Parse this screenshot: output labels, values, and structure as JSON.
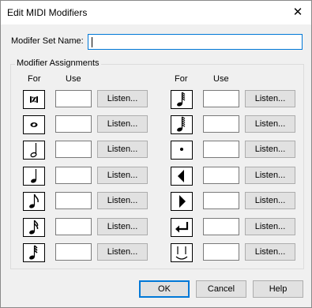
{
  "window": {
    "title": "Edit MIDI Modifiers",
    "close_icon": "close-icon"
  },
  "modifier_set": {
    "label": "Modifer Set Name:",
    "value": ""
  },
  "assignments": {
    "group_label": "Modifier Assignments",
    "col_for": "For",
    "col_use": "Use",
    "listen_label": "Listen...",
    "left": [
      {
        "icon": "measure-repeat-icon",
        "value": ""
      },
      {
        "icon": "whole-note-icon",
        "value": ""
      },
      {
        "icon": "half-note-icon",
        "value": ""
      },
      {
        "icon": "quarter-note-icon",
        "value": ""
      },
      {
        "icon": "eighth-note-icon",
        "value": ""
      },
      {
        "icon": "sixteenth-note-icon",
        "value": ""
      },
      {
        "icon": "thirty-second-note-icon",
        "value": ""
      }
    ],
    "right": [
      {
        "icon": "sixty-fourth-note-icon",
        "value": ""
      },
      {
        "icon": "hundred-twenty-eighth-note-icon",
        "value": ""
      },
      {
        "icon": "dot-icon",
        "value": ""
      },
      {
        "icon": "left-triangle-icon",
        "value": ""
      },
      {
        "icon": "right-triangle-icon",
        "value": ""
      },
      {
        "icon": "enter-arrow-icon",
        "value": ""
      },
      {
        "icon": "tie-icon",
        "value": ""
      }
    ]
  },
  "buttons": {
    "ok": "OK",
    "cancel": "Cancel",
    "help": "Help"
  }
}
